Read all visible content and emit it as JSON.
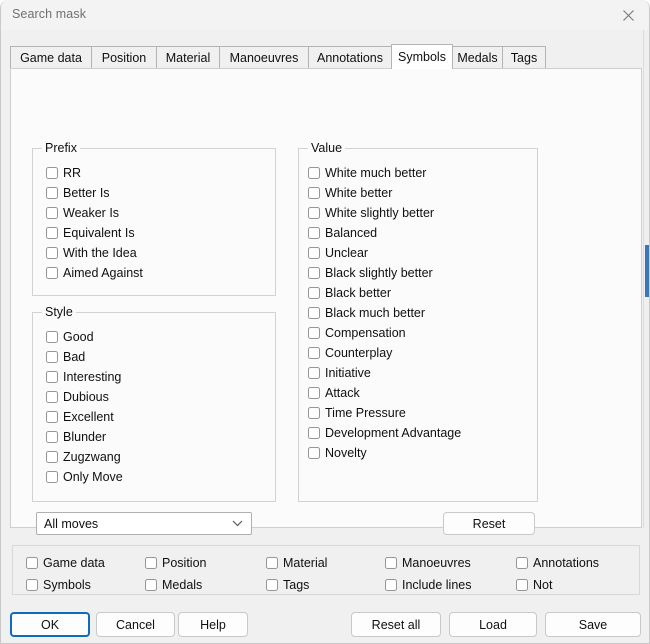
{
  "window": {
    "title": "Search mask",
    "close_icon": "close-icon"
  },
  "tabs": [
    {
      "label": "Game data",
      "active": false
    },
    {
      "label": "Position",
      "active": false
    },
    {
      "label": "Material",
      "active": false
    },
    {
      "label": "Manoeuvres",
      "active": false
    },
    {
      "label": "Annotations",
      "active": false
    },
    {
      "label": "Symbols",
      "active": true
    },
    {
      "label": "Medals",
      "active": false
    },
    {
      "label": "Tags",
      "active": false
    }
  ],
  "groups": {
    "prefix": {
      "title": "Prefix",
      "items": [
        {
          "label": "RR",
          "checked": false
        },
        {
          "label": "Better Is",
          "checked": false
        },
        {
          "label": "Weaker Is",
          "checked": false
        },
        {
          "label": "Equivalent Is",
          "checked": false
        },
        {
          "label": "With the Idea",
          "checked": false
        },
        {
          "label": "Aimed Against",
          "checked": false
        }
      ]
    },
    "style": {
      "title": "Style",
      "items": [
        {
          "label": "Good",
          "checked": false
        },
        {
          "label": "Bad",
          "checked": false
        },
        {
          "label": "Interesting",
          "checked": false
        },
        {
          "label": "Dubious",
          "checked": false
        },
        {
          "label": "Excellent",
          "checked": false
        },
        {
          "label": "Blunder",
          "checked": false
        },
        {
          "label": "Zugzwang",
          "checked": false
        },
        {
          "label": "Only Move",
          "checked": false
        }
      ]
    },
    "value": {
      "title": "Value",
      "items": [
        {
          "label": "White much better",
          "checked": false
        },
        {
          "label": "White better",
          "checked": false
        },
        {
          "label": "White slightly better",
          "checked": false
        },
        {
          "label": "Balanced",
          "checked": false
        },
        {
          "label": "Unclear",
          "checked": false
        },
        {
          "label": "Black slightly better",
          "checked": false
        },
        {
          "label": "Black better",
          "checked": false
        },
        {
          "label": "Black much better",
          "checked": false
        },
        {
          "label": "Compensation",
          "checked": false
        },
        {
          "label": "Counterplay",
          "checked": false
        },
        {
          "label": "Initiative",
          "checked": false
        },
        {
          "label": "Attack",
          "checked": false
        },
        {
          "label": "Time Pressure",
          "checked": false
        },
        {
          "label": "Development Advantage",
          "checked": false
        },
        {
          "label": "Novelty",
          "checked": false
        }
      ]
    }
  },
  "moves_select": {
    "value": "All moves",
    "arrow_icon": "chevron-down-icon"
  },
  "reset_button": {
    "label": "Reset"
  },
  "scope": {
    "items": [
      {
        "label": "Game data",
        "checked": false
      },
      {
        "label": "Position",
        "checked": false
      },
      {
        "label": "Material",
        "checked": false
      },
      {
        "label": "Manoeuvres",
        "checked": false
      },
      {
        "label": "Annotations",
        "checked": false
      },
      {
        "label": "Symbols",
        "checked": false
      },
      {
        "label": "Medals",
        "checked": false
      },
      {
        "label": "Tags",
        "checked": false
      },
      {
        "label": "Include lines",
        "checked": false
      },
      {
        "label": "Not",
        "checked": false
      }
    ]
  },
  "footer": {
    "ok": "OK",
    "cancel": "Cancel",
    "help": "Help",
    "reset_all": "Reset all",
    "load": "Load",
    "save": "Save"
  },
  "colors": {
    "accent": "#0f6cbd",
    "window_bg": "#f0f0f0",
    "page_bg": "#fbfbfb",
    "scroll_thumb": "#3a76b8"
  }
}
